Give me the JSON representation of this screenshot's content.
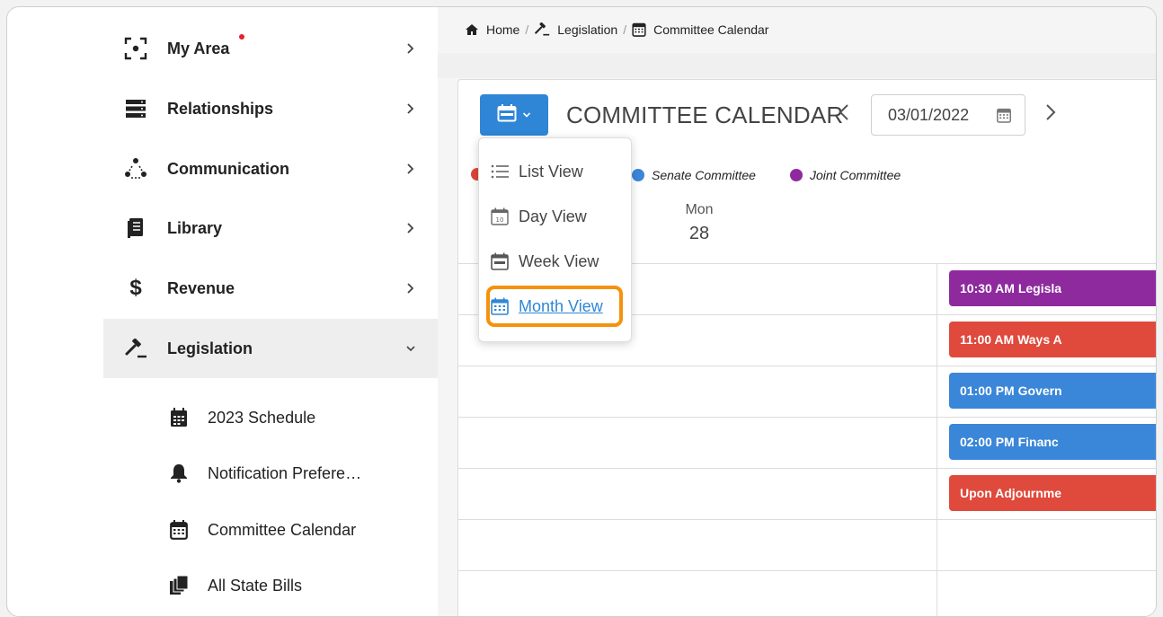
{
  "sidebar": {
    "items": [
      {
        "label": "My Area",
        "icon": "target-frame-icon"
      },
      {
        "label": "Relationships",
        "icon": "server-stack-icon"
      },
      {
        "label": "Communication",
        "icon": "people-network-icon"
      },
      {
        "label": "Library",
        "icon": "book-icon"
      },
      {
        "label": "Revenue",
        "icon": "dollar-icon"
      },
      {
        "label": "Legislation",
        "icon": "gavel-icon"
      }
    ],
    "subitems": [
      {
        "label": "2023 Schedule",
        "icon": "calendar-icon"
      },
      {
        "label": "Notification Prefere…",
        "icon": "bell-icon"
      },
      {
        "label": "Committee Calendar",
        "icon": "calendar-grid-icon"
      },
      {
        "label": "All State Bills",
        "icon": "documents-icon"
      }
    ]
  },
  "breadcrumb": {
    "home": "Home",
    "legislation": "Legislation",
    "current": "Committee Calendar"
  },
  "calendar": {
    "title": "COMMITTEE CALENDAR",
    "date_value": "03/01/2022",
    "legend": [
      {
        "label": "Senate Committee",
        "color": "#3a86d8"
      },
      {
        "label": "Joint Committee",
        "color": "#8e2a9e"
      }
    ],
    "legend_hidden_dot_color": "#e0443a",
    "day_name": "Mon",
    "day_number": "28",
    "events": [
      {
        "label": "10:30 AM Legisla",
        "color": "#8e2a9e"
      },
      {
        "label": "11:00 AM Ways A",
        "color": "#df4a3c"
      },
      {
        "label": "01:00 PM Govern",
        "color": "#3a86d8"
      },
      {
        "label": "02:00 PM Financ",
        "color": "#3a86d8"
      },
      {
        "label": "Upon Adjournme",
        "color": "#df4a3c"
      }
    ]
  },
  "view_menu": {
    "items": [
      {
        "label": "List View"
      },
      {
        "label": "Day View",
        "icon_text": "10"
      },
      {
        "label": "Week View"
      },
      {
        "label": "Month View"
      }
    ]
  },
  "colors": {
    "accent": "#2f86d6",
    "highlight": "#f5920d"
  }
}
